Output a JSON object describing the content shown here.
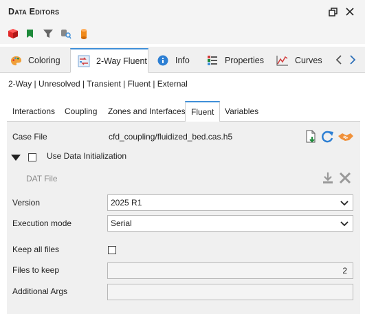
{
  "panel": {
    "title": "Data Editors"
  },
  "toolbar": {
    "icons": [
      "red-cube-icon",
      "green-flag-icon",
      "filter-icon",
      "search-database-icon",
      "orange-cylinder-icon"
    ]
  },
  "main_tabs": [
    {
      "label": "Coloring",
      "icon": "palette-icon",
      "active": false
    },
    {
      "label": "2-Way Fluent",
      "icon": "coupling-icon",
      "active": true
    },
    {
      "label": "Info",
      "icon": "info-icon",
      "active": false
    },
    {
      "label": "Properties",
      "icon": "properties-icon",
      "active": false
    },
    {
      "label": "Curves",
      "icon": "curve-icon",
      "active": false
    }
  ],
  "breadcrumb": "2-Way | Unresolved | Transient | Fluent | External",
  "sub_tabs": [
    {
      "label": "Interactions",
      "active": false
    },
    {
      "label": "Coupling",
      "active": false
    },
    {
      "label": "Zones and Interfaces",
      "active": false
    },
    {
      "label": "Fluent",
      "active": true
    },
    {
      "label": "Variables",
      "active": false
    }
  ],
  "form": {
    "case_file_label": "Case File",
    "case_file_value": "cfd_coupling/fluidized_bed.cas.h5",
    "use_data_init_label": "Use Data Initialization",
    "use_data_init_checked": false,
    "dat_file_label": "DAT File",
    "version_label": "Version",
    "version_value": "2025 R1",
    "execution_mode_label": "Execution mode",
    "execution_mode_value": "Serial",
    "keep_all_files_label": "Keep all files",
    "keep_all_files_checked": false,
    "files_to_keep_label": "Files to keep",
    "files_to_keep_value": "2",
    "additional_args_label": "Additional Args",
    "additional_args_value": ""
  },
  "colors": {
    "accent_blue": "#3f8fd8",
    "panel_bg": "#f0f0f0",
    "header_bg": "#f4f4f4"
  }
}
